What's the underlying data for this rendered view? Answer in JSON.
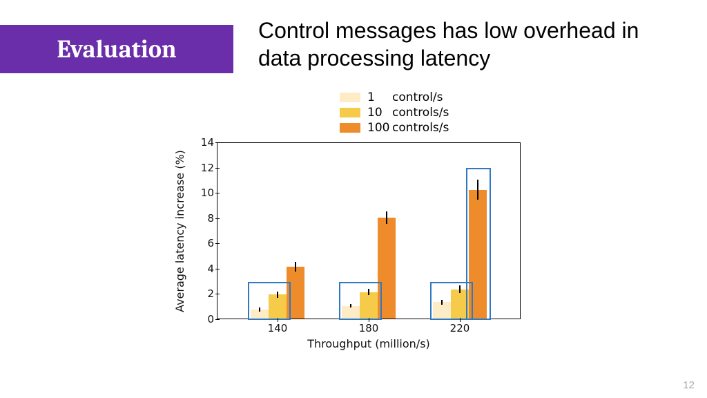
{
  "badge": {
    "label": "Evaluation"
  },
  "headline": "Control messages has low overhead in data processing latency",
  "page_number": "12",
  "colors": {
    "series1": "#fdecc6",
    "series2": "#f7cb4a",
    "series3": "#ee8b2b",
    "annotation": "#2f78c2",
    "badge_bg": "#6a2eaa"
  },
  "chart_data": {
    "type": "bar",
    "xlabel": "Throughput (million/s)",
    "ylabel": "Average latency increase (%)",
    "ylim": [
      0,
      14
    ],
    "yticks": [
      0,
      2,
      4,
      6,
      8,
      10,
      12,
      14
    ],
    "categories": [
      "140",
      "180",
      "220"
    ],
    "series": [
      {
        "name": "1",
        "unit": "control/s",
        "values": [
          0.7,
          1.0,
          1.3
        ],
        "err": [
          0.15,
          0.15,
          0.2
        ]
      },
      {
        "name": "10",
        "unit": "controls/s",
        "values": [
          1.9,
          2.1,
          2.3
        ],
        "err": [
          0.25,
          0.25,
          0.3
        ]
      },
      {
        "name": "100",
        "unit": "controls/s",
        "values": [
          4.1,
          8.0,
          10.2
        ],
        "err": [
          0.4,
          0.5,
          0.8
        ]
      }
    ]
  }
}
